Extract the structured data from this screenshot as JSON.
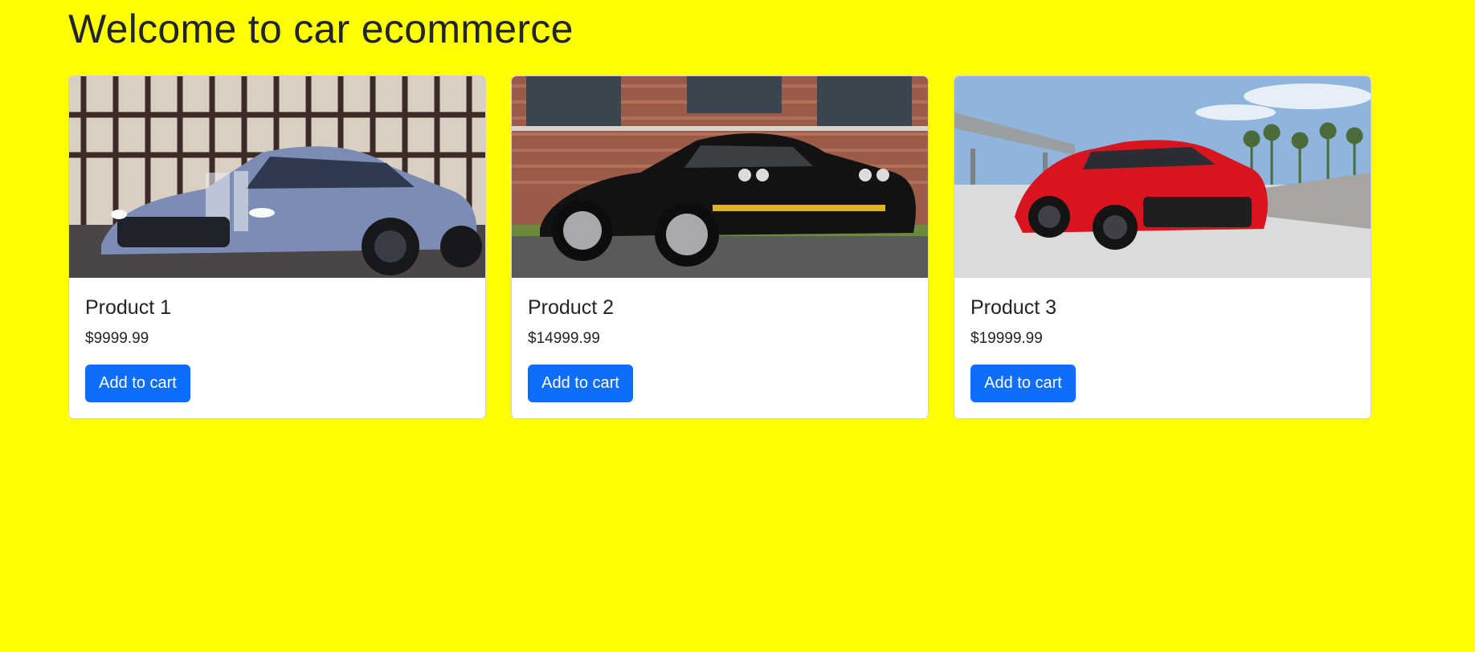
{
  "colors": {
    "page_background": "#ffff00",
    "button_background": "#0d6efd",
    "button_text": "#ffffff"
  },
  "page": {
    "title": "Welcome to car ecommerce"
  },
  "products": [
    {
      "title": "Product 1",
      "price": "$9999.99",
      "button_label": "Add to cart",
      "image_description_icon": "blue-sports-car-image"
    },
    {
      "title": "Product 2",
      "price": "$14999.99",
      "button_label": "Add to cart",
      "image_description_icon": "black-muscle-car-image"
    },
    {
      "title": "Product 3",
      "price": "$19999.99",
      "button_label": "Add to cart",
      "image_description_icon": "red-supercar-image"
    }
  ]
}
